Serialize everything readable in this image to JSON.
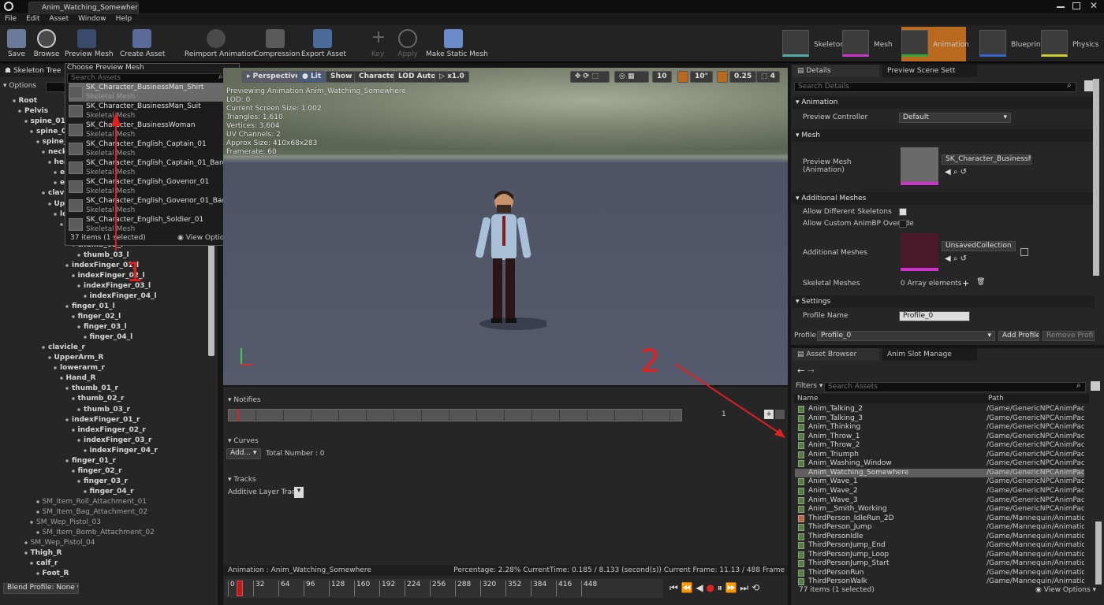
{
  "window": {
    "tab_title": "Anim_Watching_Somewhere"
  },
  "menu": [
    "File",
    "Edit",
    "Asset",
    "Window",
    "Help"
  ],
  "toolbar": {
    "buttons": [
      "Save",
      "Browse",
      "Preview Mesh",
      "Create Asset",
      "Reimport Animation",
      "Compression",
      "Export Asset",
      "Key",
      "Apply",
      "Make Static Mesh"
    ],
    "modes": [
      "Skeleton",
      "Mesh",
      "Animation",
      "Blueprint",
      "Physics"
    ]
  },
  "skeleton_tree": {
    "title": "Skeleton Tree",
    "options": "Options",
    "bones": [
      {
        "n": "Root",
        "i": 1
      },
      {
        "n": "Pelvis",
        "i": 2
      },
      {
        "n": "spine_01",
        "i": 3
      },
      {
        "n": "spine_02",
        "i": 4
      },
      {
        "n": "spine_03",
        "i": 5
      },
      {
        "n": "neck",
        "i": 6
      },
      {
        "n": "head",
        "i": 7
      },
      {
        "n": "e",
        "i": 8
      },
      {
        "n": "e",
        "i": 8
      },
      {
        "n": "clavicle_l",
        "i": 6
      },
      {
        "n": "UpperArm_L",
        "i": 7
      },
      {
        "n": "lowerarm_l",
        "i": 8
      },
      {
        "n": "Hand_L",
        "i": 9
      },
      {
        "n": "thumb_01_l",
        "i": 10
      },
      {
        "n": "thumb_02_l",
        "i": 11
      },
      {
        "n": "thumb_03_l",
        "i": 12
      },
      {
        "n": "indexFinger_01_l",
        "i": 10
      },
      {
        "n": "indexFinger_02_l",
        "i": 11
      },
      {
        "n": "indexFinger_03_l",
        "i": 12
      },
      {
        "n": "indexFinger_04_l",
        "i": 13
      },
      {
        "n": "finger_01_l",
        "i": 10
      },
      {
        "n": "finger_02_l",
        "i": 11
      },
      {
        "n": "finger_03_l",
        "i": 12
      },
      {
        "n": "finger_04_l",
        "i": 13
      },
      {
        "n": "clavicle_r",
        "i": 6
      },
      {
        "n": "UpperArm_R",
        "i": 7
      },
      {
        "n": "lowerarm_r",
        "i": 8
      },
      {
        "n": "Hand_R",
        "i": 9
      },
      {
        "n": "thumb_01_r",
        "i": 10
      },
      {
        "n": "thumb_02_r",
        "i": 11
      },
      {
        "n": "thumb_03_r",
        "i": 12
      },
      {
        "n": "indexFinger_01_r",
        "i": 10
      },
      {
        "n": "indexFinger_02_r",
        "i": 11
      },
      {
        "n": "indexFinger_03_r",
        "i": 12
      },
      {
        "n": "indexFinger_04_r",
        "i": 13
      },
      {
        "n": "finger_01_r",
        "i": 10
      },
      {
        "n": "finger_02_r",
        "i": 11
      },
      {
        "n": "finger_03_r",
        "i": 12
      },
      {
        "n": "finger_04_r",
        "i": 13
      },
      {
        "n": "SM_Item_Roll_Attachment_01",
        "i": 5,
        "att": true
      },
      {
        "n": "SM_Item_Bag_Attachment_02",
        "i": 5,
        "att": true
      },
      {
        "n": "SM_Wep_Pistol_03",
        "i": 4,
        "att": true
      },
      {
        "n": "SM_Item_Bomb_Attachment_02",
        "i": 5,
        "att": true
      },
      {
        "n": "SM_Wep_Pistol_04",
        "i": 3,
        "att": true
      },
      {
        "n": "Thigh_R",
        "i": 3
      },
      {
        "n": "calf_r",
        "i": 4
      },
      {
        "n": "Foot_R",
        "i": 5
      }
    ],
    "blend_profile": "Blend Profile: None"
  },
  "preview_popup": {
    "title": "Choose Preview Mesh",
    "search": "Search Assets",
    "items": [
      {
        "name": "SK_Character_BusinessMan_Shirt",
        "type": "Skeletal Mesh"
      },
      {
        "name": "SK_Character_BusinessMan_Suit",
        "type": "Skeletal Mesh"
      },
      {
        "name": "SK_Character_BusinessWoman",
        "type": "Skeletal Mesh"
      },
      {
        "name": "SK_Character_English_Captain_01",
        "type": "Skeletal Mesh"
      },
      {
        "name": "SK_Character_English_Captain_01_Bare",
        "type": "Skeletal Mesh"
      },
      {
        "name": "SK_Character_English_Govenor_01",
        "type": "Skeletal Mesh"
      },
      {
        "name": "SK_Character_English_Govenor_01_Bare",
        "type": "Skeletal Mesh"
      },
      {
        "name": "SK_Character_English_Soldier_01",
        "type": "Skeletal Mesh"
      }
    ],
    "count": "37 items (1 selected)",
    "view_options": "View Options"
  },
  "viewport": {
    "buttons": [
      "Perspective",
      "Lit",
      "Show",
      "Character",
      "LOD Auto",
      "x1.0"
    ],
    "right_values": [
      "10",
      "10°",
      "0.25",
      "4"
    ],
    "stats": [
      "Previewing Animation Anim_Watching_Somewhere",
      "LOD: 0",
      "Current Screen Size: 1.002",
      "Triangles: 1,610",
      "Vertices: 3,604",
      "UV Channels: 2",
      "Approx Size: 410x68x283",
      "Framerate: 60"
    ]
  },
  "timeline": {
    "notifies": "Notifies",
    "notify_track": "1",
    "curves": "Curves",
    "add": "Add...",
    "total": "Total Number : 0",
    "tracks": "Tracks",
    "additive": "Additive Layer Tracks",
    "status_anim": "Animation :  Anim_Watching_Somewhere",
    "status_right": "Percentage:  2.28% CurrentTime:  0.185 / 8.133 (second(s)) Current Frame:  11.13 / 488 Frame",
    "ticks": [
      "0",
      "32",
      "64",
      "96",
      "128",
      "160",
      "192",
      "224",
      "256",
      "288",
      "320",
      "352",
      "384",
      "416",
      "448"
    ],
    "progress": 0.0228
  },
  "details": {
    "tab": "Details",
    "tab2": "Preview Scene Sett",
    "search": "Search Details",
    "sections": {
      "animation": "Animation",
      "mesh": "Mesh",
      "additional": "Additional Meshes",
      "settings": "Settings"
    },
    "preview_controller": {
      "label": "Preview Controller",
      "value": "Default"
    },
    "preview_mesh": {
      "label": "Preview Mesh\n(Animation)",
      "value": "SK_Character_BusinessMan_"
    },
    "allow_diff": "Allow Different Skeletons",
    "allow_custom": "Allow Custom AnimBP Override",
    "additional_meshes": {
      "label": "Additional Meshes",
      "value": "UnsavedCollection"
    },
    "skeletal_meshes": {
      "label": "Skeletal Meshes",
      "value": "0 Array elements"
    },
    "profile_name": {
      "label": "Profile Name",
      "value": "Profile_0"
    },
    "profile": {
      "label": "Profile",
      "value": "Profile_0",
      "add": "Add Profile",
      "remove": "Remove Profile"
    }
  },
  "asset_browser": {
    "tab": "Asset Browser",
    "tab2": "Anim Slot Manage",
    "filters": "Filters",
    "search": "Search Assets",
    "col_name": "Name",
    "col_path": "Path",
    "rows": [
      {
        "n": "Anim_Talking_2",
        "p": "/Game/GenericNPCAnimPack/A"
      },
      {
        "n": "Anim_Talking_3",
        "p": "/Game/GenericNPCAnimPack/A"
      },
      {
        "n": "Anim_Thinking",
        "p": "/Game/GenericNPCAnimPack/A"
      },
      {
        "n": "Anim_Throw_1",
        "p": "/Game/GenericNPCAnimPack/A"
      },
      {
        "n": "Anim_Throw_2",
        "p": "/Game/GenericNPCAnimPack/A"
      },
      {
        "n": "Anim_Triumph",
        "p": "/Game/GenericNPCAnimPack/A"
      },
      {
        "n": "Anim_Washing_Window",
        "p": "/Game/GenericNPCAnimPack/A"
      },
      {
        "n": "Anim_Watching_Somewhere",
        "p": "/Game/GenericNPCAnimPack/A",
        "sel": true
      },
      {
        "n": "Anim_Wave_1",
        "p": "/Game/GenericNPCAnimPack/A"
      },
      {
        "n": "Anim_Wave_2",
        "p": "/Game/GenericNPCAnimPack/A"
      },
      {
        "n": "Anim_Wave_3",
        "p": "/Game/GenericNPCAnimPack/A"
      },
      {
        "n": "Anim__Smith_Working",
        "p": "/Game/GenericNPCAnimPack/A"
      },
      {
        "n": "ThirdPerson_IdleRun_2D",
        "p": "/Game/Mannequin/Animations"
      },
      {
        "n": "ThirdPerson_Jump",
        "p": "/Game/Mannequin/Animations"
      },
      {
        "n": "ThirdPersonIdle",
        "p": "/Game/Mannequin/Animations"
      },
      {
        "n": "ThirdPersonJump_End",
        "p": "/Game/Mannequin/Animations"
      },
      {
        "n": "ThirdPersonJump_Loop",
        "p": "/Game/Mannequin/Animations"
      },
      {
        "n": "ThirdPersonJump_Start",
        "p": "/Game/Mannequin/Animations"
      },
      {
        "n": "ThirdPersonRun",
        "p": "/Game/Mannequin/Animations"
      },
      {
        "n": "ThirdPersonWalk",
        "p": "/Game/Mannequin/Animations"
      }
    ],
    "count": "77 items (1 selected)",
    "view_options": "View Options"
  },
  "annotations": {
    "one": "1",
    "two": "2"
  }
}
